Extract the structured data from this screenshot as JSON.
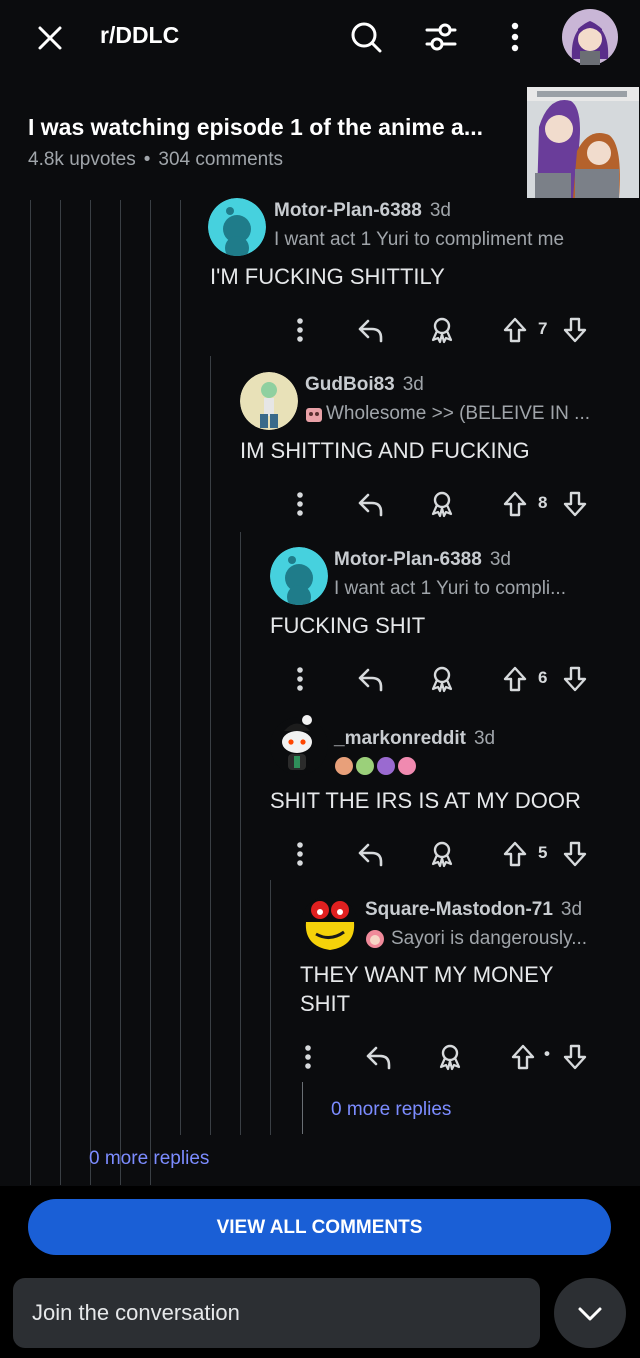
{
  "topbar": {
    "subreddit": "r/DDLC",
    "close_icon": "close-icon",
    "search_icon": "search-icon",
    "filter_icon": "sliders-icon",
    "more_icon": "more-vertical-icon"
  },
  "post": {
    "title": "I was watching episode 1 of the anime a...",
    "upvotes": "4.8k upvotes",
    "separator": "•",
    "comments": "304 comments"
  },
  "comments": [
    {
      "user": "Motor-Plan-6388",
      "age": "3d",
      "flair": "I want act 1 Yuri to compliment me",
      "body": "I'M FUCKING SHITTILY",
      "votes": "7"
    },
    {
      "user": "GudBoi83",
      "age": "3d",
      "flair": "Wholesome >> (BELEIVE IN ...",
      "body": "IM SHITTING AND FUCKING",
      "votes": "8"
    },
    {
      "user": "Motor-Plan-6388",
      "age": "3d",
      "flair": "I want act 1 Yuri to compli...",
      "body": "FUCKING SHIT",
      "votes": "6"
    },
    {
      "user": "_markonreddit",
      "age": "3d",
      "flair": "",
      "body": "SHIT THE IRS IS AT MY DOOR",
      "votes": "5"
    },
    {
      "user": "Square-Mastodon-71",
      "age": "3d",
      "flair": "Sayori is dangerously...",
      "body": "THEY WANT MY MONEY SHIT",
      "votes": "•"
    }
  ],
  "more_replies_inner": "0 more replies",
  "more_replies_outer": "0 more replies",
  "view_all_label": "VIEW ALL COMMENTS",
  "join_placeholder": "Join the conversation",
  "colors": {
    "accent": "#1a5fd6",
    "link": "#7c8cff",
    "background": "#0b0c0e"
  }
}
